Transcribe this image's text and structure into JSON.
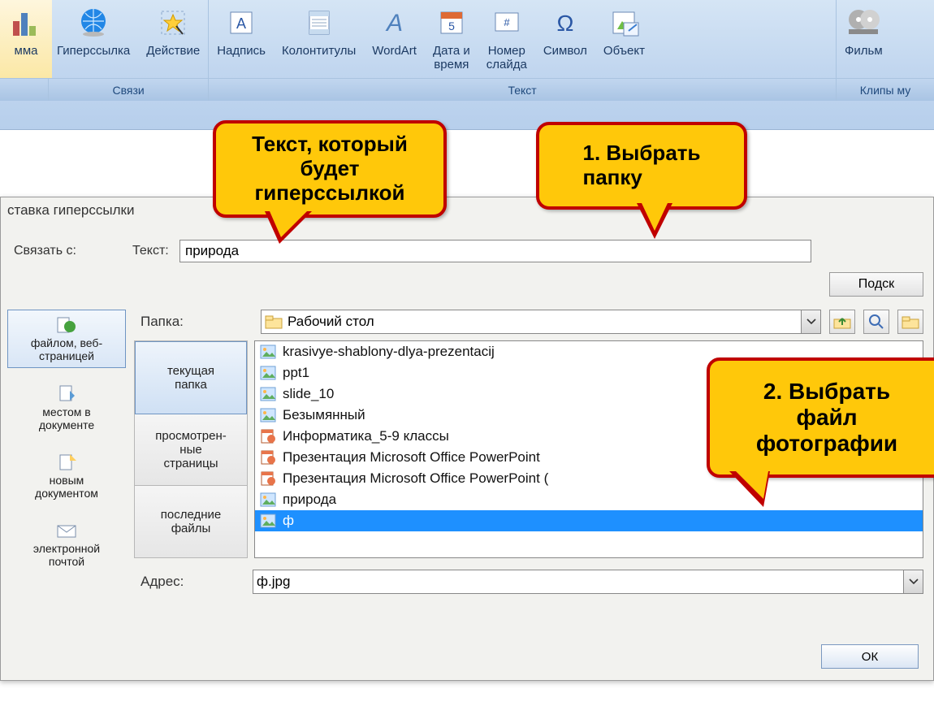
{
  "ribbon": {
    "groups": [
      {
        "caption": "",
        "items": [
          {
            "label": "мма",
            "icon": "chart-icon"
          }
        ]
      },
      {
        "caption": "Связи",
        "items": [
          {
            "label": "Гиперссылка",
            "icon": "globe-icon"
          },
          {
            "label": "Действие",
            "icon": "star-click-icon"
          }
        ]
      },
      {
        "caption": "Текст",
        "items": [
          {
            "label": "Надпись",
            "icon": "textbox-icon"
          },
          {
            "label": "Колонтитулы",
            "icon": "header-footer-icon"
          },
          {
            "label": "WordArt",
            "icon": "wordart-icon"
          },
          {
            "label": "Дата и\nвремя",
            "icon": "date-icon"
          },
          {
            "label": "Номер\nслайда",
            "icon": "slide-number-icon"
          },
          {
            "label": "Символ",
            "icon": "symbol-icon"
          },
          {
            "label": "Объект",
            "icon": "object-icon"
          }
        ]
      },
      {
        "caption": "Клипы му",
        "items": [
          {
            "label": "Фильм",
            "icon": "movie-icon"
          }
        ]
      }
    ]
  },
  "dialog": {
    "title": "ставка гиперссылки",
    "linkto_label": "Связать с:",
    "text_label": "Текст:",
    "text_value": "природа",
    "linkto_buttons": [
      {
        "label": "файлом, веб-\nстраницей",
        "icon": "file-web-icon"
      },
      {
        "label": "местом в\nдокументе",
        "icon": "bookmark-icon"
      },
      {
        "label": "новым\nдокументом",
        "icon": "new-doc-icon"
      },
      {
        "label": "электронной\nпочтой",
        "icon": "email-icon"
      }
    ],
    "folder_label": "Папка:",
    "folder_value": "Рабочий стол",
    "toolbar_icons": [
      "up-folder-icon",
      "search-icon",
      "browse-icon"
    ],
    "view_tabs": [
      "текущая\nпапка",
      "просмотрен-\nные\nстраницы",
      "последние\nфайлы"
    ],
    "files": [
      {
        "name": "krasivye-shablony-dlya-prezentacij",
        "icon": "image-icon"
      },
      {
        "name": "ppt1",
        "icon": "image-icon"
      },
      {
        "name": "slide_10",
        "icon": "image-icon"
      },
      {
        "name": "Безымянный",
        "icon": "image-icon"
      },
      {
        "name": "Информатика_5-9 классы",
        "icon": "ppt-icon"
      },
      {
        "name": "Презентация Microsoft Office PowerPoint",
        "icon": "ppt-icon"
      },
      {
        "name": "Презентация Microsoft Office PowerPoint (",
        "icon": "ppt-icon"
      },
      {
        "name": "природа",
        "icon": "image-icon"
      },
      {
        "name": "ф",
        "icon": "image-icon",
        "selected": true
      }
    ],
    "address_label": "Адрес:",
    "address_value": "ф.jpg",
    "ok_label": "ОК",
    "hint_button": "Подск"
  },
  "callouts": {
    "c1": "Текст, который\nбудет\nгиперссылкой",
    "c2": "1. Выбрать\nпапку",
    "c3": "2. Выбрать\nфайл\nфотографии"
  }
}
